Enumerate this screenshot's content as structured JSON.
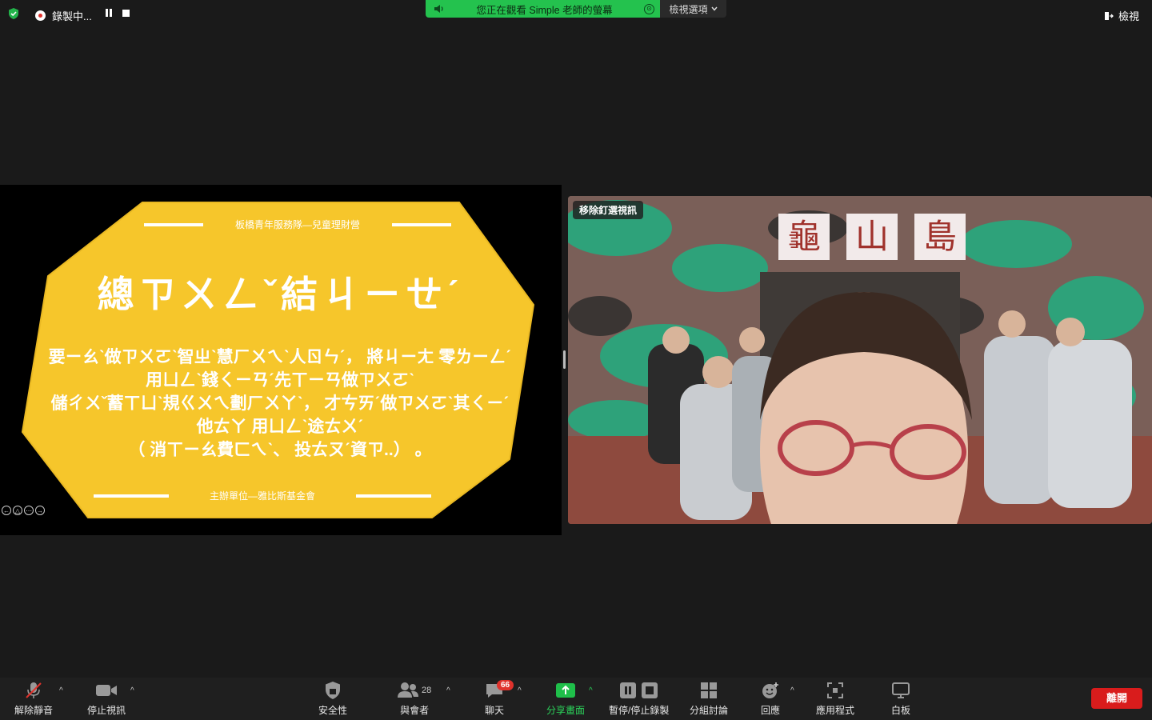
{
  "top": {
    "recording_label": "錄製中...",
    "banner_text": "您正在觀看 Simple 老師的螢幕",
    "view_options_label": "檢視選項",
    "view_label": "檢視"
  },
  "slide": {
    "header": "板橋青年服務隊—兒童理財營",
    "title": "總ㄗㄨㄥˇ結ㄐㄧㄝˊ",
    "body_line1": "要ㄧㄠˋ做ㄗㄨㄛˋ智ㄓˋ慧ㄏㄨㄟˋ人ㄖㄣˊ， 將ㄐㄧㄤ 零ㄌㄧㄥˊ用ㄩㄥˋ錢ㄑㄧㄢˊ先ㄒㄧㄢ做ㄗㄨㄛˋ",
    "body_line2": "儲ㄔㄨˇ蓄ㄒㄩˋ規ㄍㄨㄟ劃ㄏㄨㄚˋ， 才ㄘㄞˊ做ㄗㄨㄛˋ其ㄑㄧˊ他ㄊㄚ 用ㄩㄥˋ途ㄊㄨˊ",
    "body_line3": "（ 消ㄒㄧㄠ費ㄈㄟˋ、 投ㄊㄡˊ資ㄗ..） 。",
    "footer": "主辦單位—雅比斯基金會",
    "accent_color": "#f6c62b"
  },
  "video": {
    "unpin_label": "移除釘選視訊",
    "sign_chars": [
      "龜",
      "山",
      "島"
    ]
  },
  "toolbar": {
    "unmute": "解除靜音",
    "stop_video": "停止視訊",
    "security": "安全性",
    "participants": "與會者",
    "participants_count": "28",
    "chat": "聊天",
    "chat_badge": "66",
    "share_screen": "分享畫面",
    "pause_stop_recording": "暫停/停止錄製",
    "breakout_rooms": "分組討論",
    "reactions": "回應",
    "apps": "應用程式",
    "whiteboard": "白板",
    "leave": "離開"
  }
}
